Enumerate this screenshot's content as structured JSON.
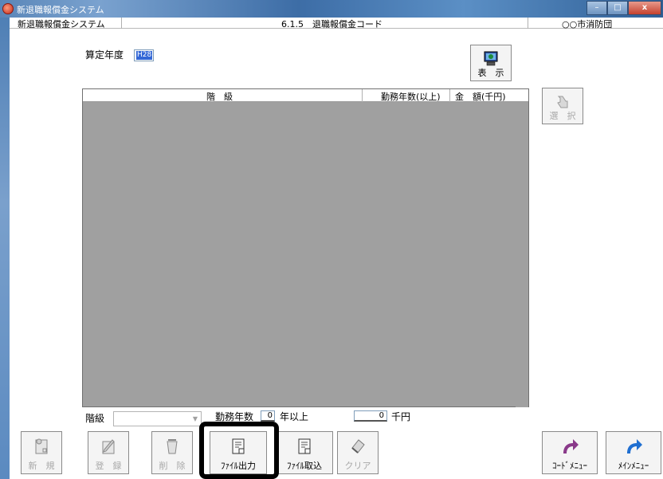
{
  "window": {
    "title": "新退職報償金システム",
    "buttons": {
      "minimize": "–",
      "maximize": "□",
      "close": "x"
    }
  },
  "infobar": {
    "system": "新退職報償金システム",
    "screen": "6.1.5　退職報償金コード",
    "org": "○○市消防団"
  },
  "calc_year": {
    "label": "算定年度",
    "value": "H28"
  },
  "buttons": {
    "display": "表　示",
    "select": "選　択",
    "new": "新　規",
    "register": "登　録",
    "delete": "削　除",
    "file_output": "ﾌｧｲﾙ出力",
    "file_import": "ﾌｧｲﾙ取込",
    "clear": "クリア",
    "code_menu": "ｺｰﾄﾞﾒﾆｭｰ",
    "main_menu": "ﾒｲﾝﾒﾆｭｰ"
  },
  "grid": {
    "columns": [
      "階　級",
      "勤務年数(以上)",
      "金　額(千円)"
    ],
    "rows": []
  },
  "form": {
    "rank_label": "階級",
    "rank_value": "",
    "years_label": "勤務年数",
    "years_value": "0",
    "years_unit": "年以上",
    "amount_value": "0",
    "amount_unit": "千円"
  },
  "colors": {
    "grid_bg": "#a0a0a0",
    "accent_blue": "#3367d6",
    "menu_arrow": "#1f6fd1",
    "code_arrow": "#8a3a8a"
  }
}
